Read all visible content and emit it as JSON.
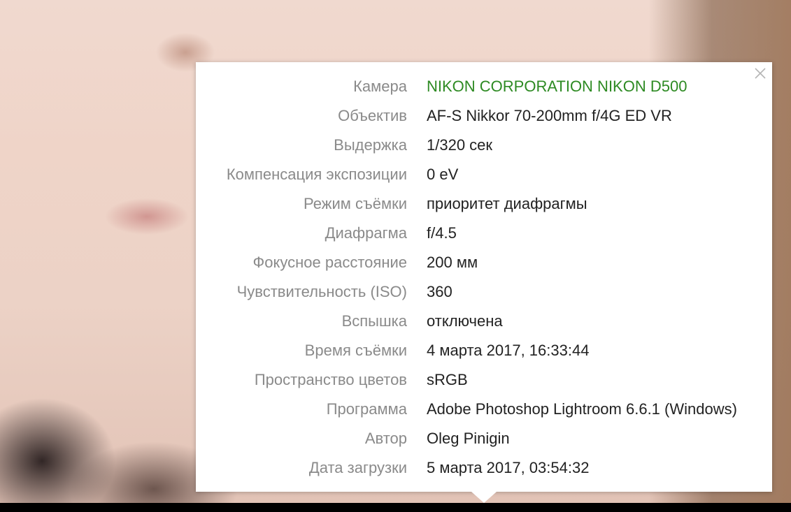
{
  "exif": {
    "rows": [
      {
        "label": "Камера",
        "value": "NIKON CORPORATION NIKON D500"
      },
      {
        "label": "Объектив",
        "value": "AF-S Nikkor 70-200mm f/4G ED VR"
      },
      {
        "label": "Выдержка",
        "value": "1/320 сек"
      },
      {
        "label": "Компенсация экспозиции",
        "value": "0 eV"
      },
      {
        "label": "Режим съёмки",
        "value": "приоритет диафрагмы"
      },
      {
        "label": "Диафрагма",
        "value": "f/4.5"
      },
      {
        "label": "Фокусное расстояние",
        "value": "200 мм"
      },
      {
        "label": "Чувствительность (ISO)",
        "value": "360"
      },
      {
        "label": "Вспышка",
        "value": "отключена"
      },
      {
        "label": "Время съёмки",
        "value": "4 марта 2017, 16:33:44"
      },
      {
        "label": "Пространство цветов",
        "value": "sRGB"
      },
      {
        "label": "Программа",
        "value": "Adobe Photoshop Lightroom 6.6.1 (Windows)"
      },
      {
        "label": "Автор",
        "value": "Oleg Pinigin"
      },
      {
        "label": "Дата загрузки",
        "value": "5 марта 2017, 03:54:32"
      }
    ]
  },
  "close_icon": "close-icon",
  "colors": {
    "link": "#2d8a22",
    "label": "#8a8a8a",
    "value": "#222222"
  }
}
